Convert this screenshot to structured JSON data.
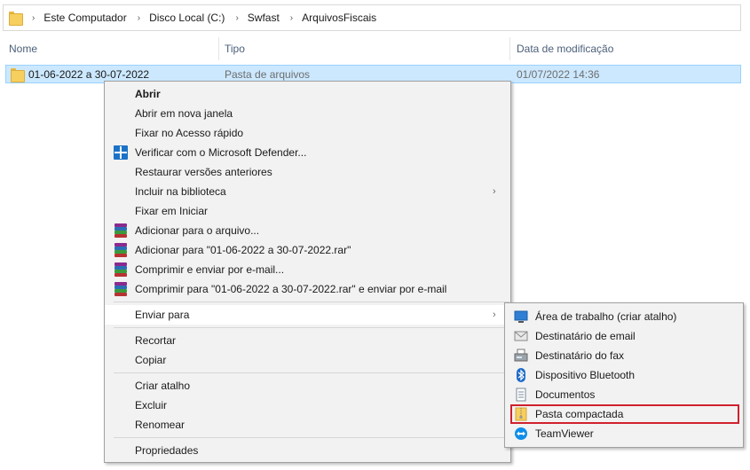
{
  "breadcrumb": {
    "items": [
      "Este Computador",
      "Disco Local (C:)",
      "Swfast",
      "ArquivosFiscais"
    ],
    "separator": "›"
  },
  "columns": {
    "name": "Nome",
    "type": "Tipo",
    "modified": "Data de modificação"
  },
  "file_row": {
    "name": "01-06-2022 a 30-07-2022",
    "type": "Pasta de arquivos",
    "modified": "01/07/2022 14:36"
  },
  "context_menu": {
    "items": [
      {
        "label": "Abrir"
      },
      {
        "label": "Abrir em nova janela"
      },
      {
        "label": "Fixar no Acesso rápido"
      },
      {
        "label": "Verificar com o Microsoft Defender..."
      },
      {
        "label": "Restaurar versões anteriores"
      },
      {
        "label": "Incluir na biblioteca"
      },
      {
        "label": "Fixar em Iniciar"
      },
      {
        "label": "Adicionar para o arquivo..."
      },
      {
        "label": "Adicionar para \"01-06-2022 a 30-07-2022.rar\""
      },
      {
        "label": "Comprimir e enviar por e-mail..."
      },
      {
        "label": "Comprimir para \"01-06-2022 a 30-07-2022.rar\" e enviar por e-mail"
      },
      {
        "label": "Enviar para"
      },
      {
        "label": "Recortar"
      },
      {
        "label": "Copiar"
      },
      {
        "label": "Criar atalho"
      },
      {
        "label": "Excluir"
      },
      {
        "label": "Renomear"
      },
      {
        "label": "Propriedades"
      }
    ],
    "submenu_arrow": "›"
  },
  "send_to_menu": {
    "items": [
      {
        "label": "Área de trabalho (criar atalho)",
        "icon": "desktop-icon"
      },
      {
        "label": "Destinatário de email",
        "icon": "mail-icon"
      },
      {
        "label": "Destinatário do fax",
        "icon": "fax-icon"
      },
      {
        "label": "Dispositivo Bluetooth",
        "icon": "bluetooth-icon"
      },
      {
        "label": "Documentos",
        "icon": "documents-icon"
      },
      {
        "label": "Pasta compactada",
        "icon": "zip-folder-icon"
      },
      {
        "label": "TeamViewer",
        "icon": "teamviewer-icon"
      }
    ]
  },
  "colors": {
    "selection": "#cce8ff",
    "highlight_outline": "#d0202d",
    "menu_bg": "#f2f2f2"
  }
}
